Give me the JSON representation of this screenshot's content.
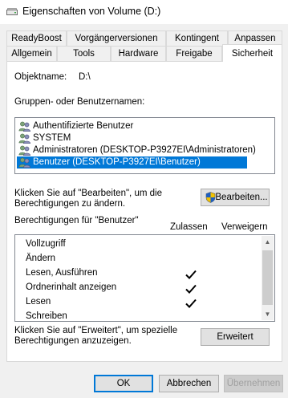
{
  "window": {
    "title": "Eigenschaften von Volume (D:)"
  },
  "tabs": {
    "row1": [
      "ReadyBoost",
      "Vorgängerversionen",
      "Kontingent",
      "Anpassen"
    ],
    "row2": [
      "Allgemein",
      "Tools",
      "Hardware",
      "Freigabe",
      "Sicherheit"
    ],
    "active": "Sicherheit"
  },
  "security": {
    "object_label": "Objektname:",
    "object_value": "D:\\",
    "groups_label": "Gruppen- oder Benutzernamen:",
    "users": [
      "Authentifizierte Benutzer",
      "SYSTEM",
      "Administratoren (DESKTOP-P3927EI\\Administratoren)",
      "Benutzer (DESKTOP-P3927EI\\Benutzer)"
    ],
    "selected_user_index": 3,
    "edit_hint": "Klicken Sie auf \"Bearbeiten\", um die Berechtigungen zu ändern.",
    "edit_hint_line1": "Klicken Sie auf \"Bearbeiten\", um die",
    "edit_hint_line2": "Berechtigungen zu ändern.",
    "edit_button": "Bearbeiten...",
    "perm_title": "Berechtigungen für \"Benutzer\"",
    "col_allow": "Zulassen",
    "col_deny": "Verweigern",
    "permissions": [
      {
        "name": "Vollzugriff",
        "allow": false,
        "deny": false
      },
      {
        "name": "Ändern",
        "allow": false,
        "deny": false
      },
      {
        "name": "Lesen, Ausführen",
        "allow": true,
        "deny": false
      },
      {
        "name": "Ordnerinhalt anzeigen",
        "allow": true,
        "deny": false
      },
      {
        "name": "Lesen",
        "allow": true,
        "deny": false
      },
      {
        "name": "Schreiben",
        "allow": false,
        "deny": false
      }
    ],
    "advanced_hint_line1": "Klicken Sie auf \"Erweitert\", um spezielle",
    "advanced_hint_line2": "Berechtigungen anzuzeigen.",
    "advanced_button": "Erweitert"
  },
  "footer": {
    "ok": "OK",
    "cancel": "Abbrechen",
    "apply": "Übernehmen"
  },
  "colors": {
    "selection": "#0078d7",
    "shield_blue": "#1f5fbf",
    "shield_yellow": "#f2c200"
  }
}
